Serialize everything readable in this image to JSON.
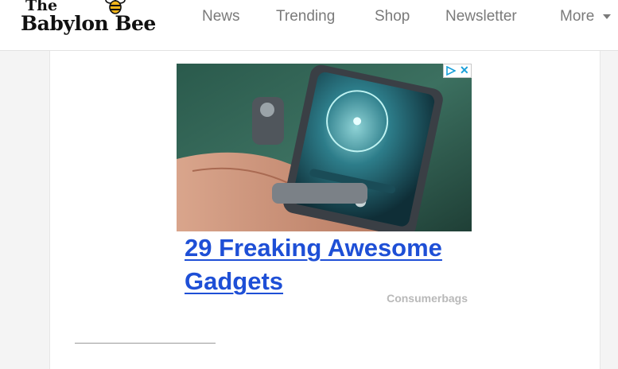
{
  "header": {
    "logo": {
      "the": "The",
      "name": "Babylon Bee"
    },
    "nav": [
      {
        "label": "News"
      },
      {
        "label": "Trending"
      },
      {
        "label": "Shop"
      },
      {
        "label": "Newsletter"
      },
      {
        "label": "More"
      }
    ]
  },
  "ad": {
    "headline": "29 Freaking Awesome Gadgets",
    "source": "Consumerbags",
    "choices_close": "✕",
    "icons": [
      "adchoices-icon",
      "close-icon",
      "chevron-down-icon",
      "bee-icon"
    ]
  },
  "colors": {
    "headline": "#1e4fd6",
    "nav_text": "#7a7a7a",
    "adchoices": "#1a9fd8"
  }
}
